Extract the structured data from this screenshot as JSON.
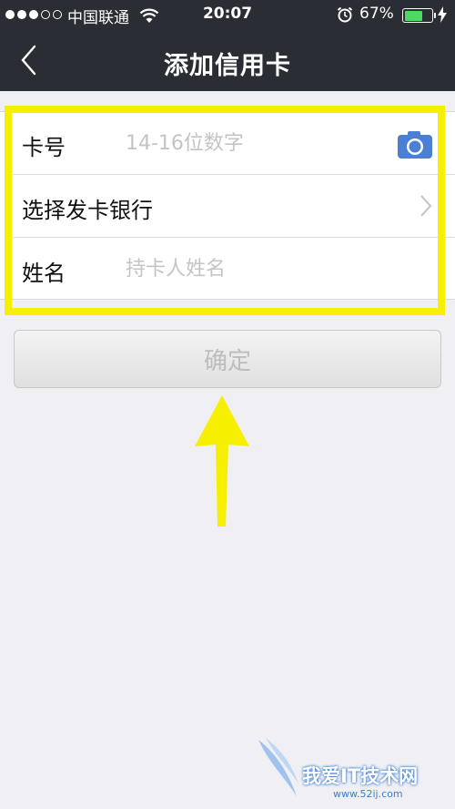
{
  "status_bar": {
    "carrier": "中国联通",
    "time": "20:07",
    "battery_percent": "67%",
    "battery_level": 0.67,
    "signal_bars_filled": 3,
    "signal_bars_total": 5
  },
  "nav": {
    "back_icon": "chevron-left-icon",
    "title": "添加信用卡"
  },
  "form": {
    "card_number": {
      "label": "卡号",
      "placeholder": "14-16位数字",
      "value": "",
      "icon": "camera-icon"
    },
    "bank": {
      "label": "选择发卡银行",
      "icon": "chevron-right-icon"
    },
    "name": {
      "label": "姓名",
      "placeholder": "持卡人姓名",
      "value": ""
    }
  },
  "confirm_button": {
    "label": "确定"
  },
  "annotation": {
    "color": "#f6f000"
  },
  "watermark": {
    "text": "我爱IT技术网",
    "url": "www.52ij.com"
  },
  "colors": {
    "header_bg": "#2b2d34",
    "page_bg": "#efeff4",
    "battery_green": "#4cd964",
    "camera_blue": "#4a7fd3"
  }
}
